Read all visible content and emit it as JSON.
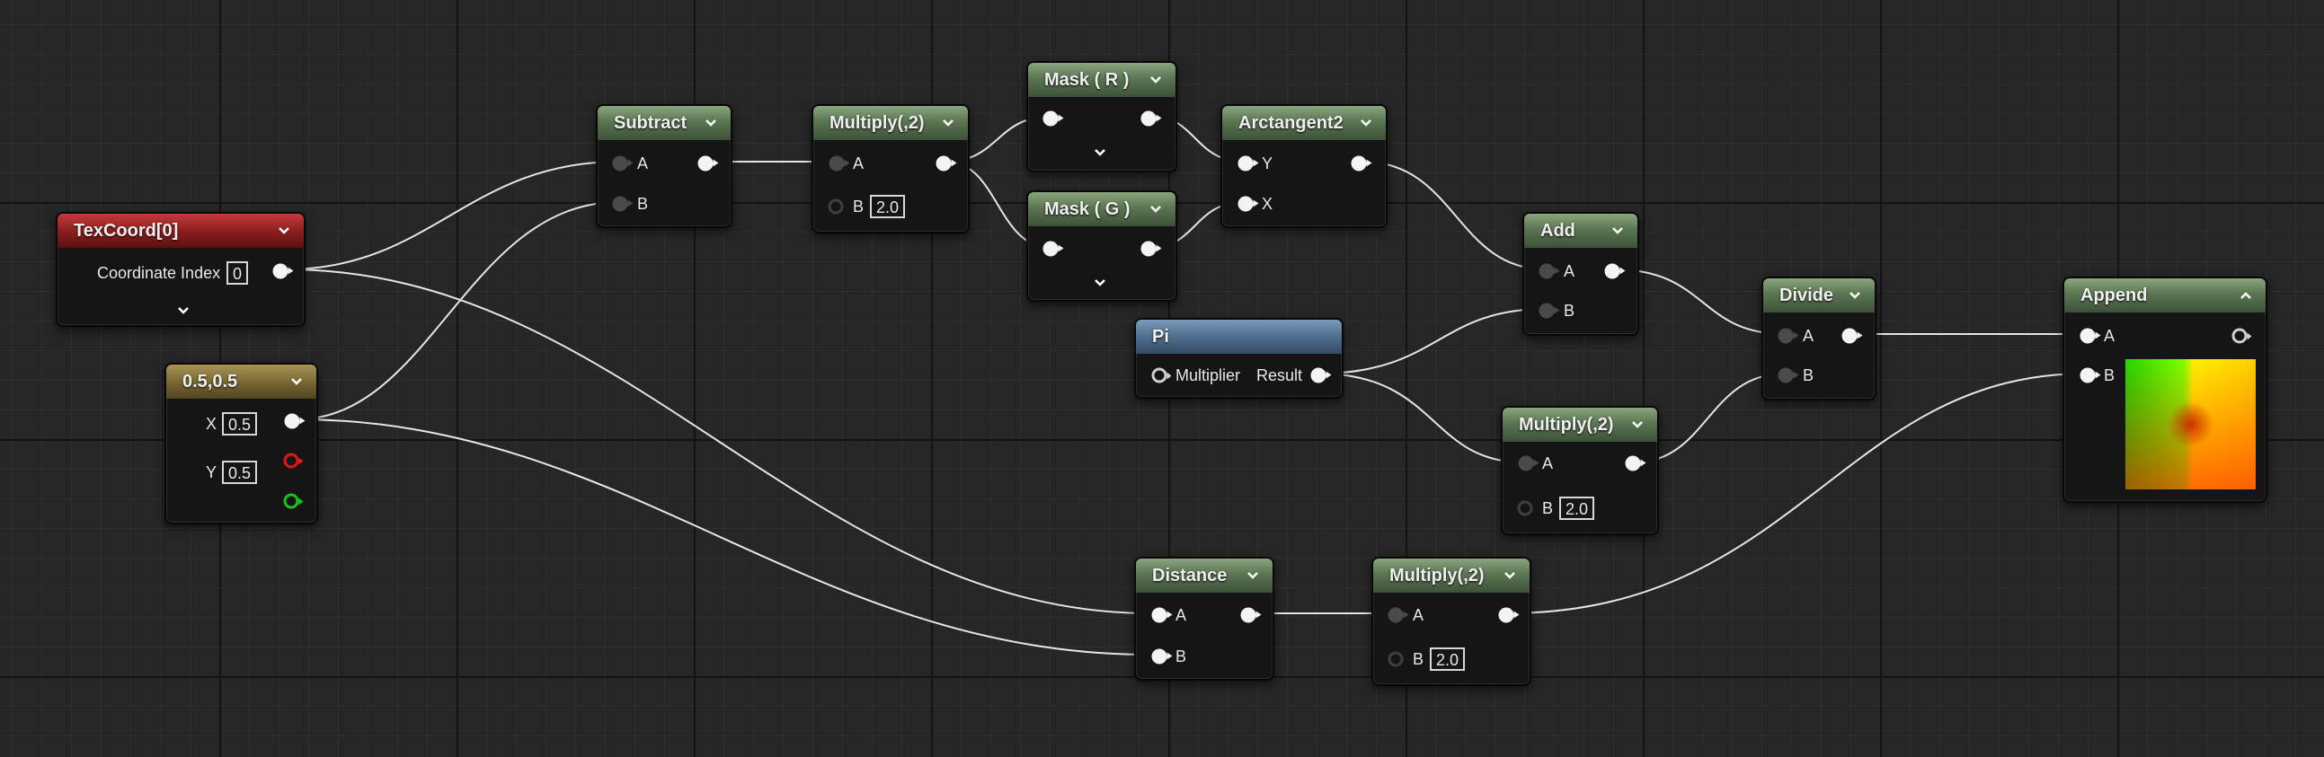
{
  "graph": {
    "texcoord": {
      "title": "TexCoord[0]",
      "coordinate_label": "Coordinate Index",
      "coordinate_value": "0"
    },
    "constant2": {
      "title": "0.5,0.5",
      "x_label": "X",
      "x_value": "0.5",
      "y_label": "Y",
      "y_value": "0.5"
    },
    "subtract": {
      "title": "Subtract",
      "a_label": "A",
      "b_label": "B"
    },
    "multiply1": {
      "title": "Multiply(,2)",
      "a_label": "A",
      "b_label": "B",
      "b_value": "2.0"
    },
    "mask_r": {
      "title": "Mask ( R )"
    },
    "mask_g": {
      "title": "Mask ( G )"
    },
    "arctangent2": {
      "title": "Arctangent2",
      "y_label": "Y",
      "x_label": "X"
    },
    "add": {
      "title": "Add",
      "a_label": "A",
      "b_label": "B"
    },
    "pi": {
      "title": "Pi",
      "multiplier_label": "Multiplier",
      "result_label": "Result"
    },
    "multiply2": {
      "title": "Multiply(,2)",
      "a_label": "A",
      "b_label": "B",
      "b_value": "2.0"
    },
    "divide": {
      "title": "Divide",
      "a_label": "A",
      "b_label": "B"
    },
    "append": {
      "title": "Append",
      "a_label": "A",
      "b_label": "B"
    },
    "distance": {
      "title": "Distance",
      "a_label": "A",
      "b_label": "B"
    },
    "multiply3": {
      "title": "Multiply(,2)",
      "a_label": "A",
      "b_label": "B",
      "b_value": "2.0"
    }
  },
  "colors": {
    "wire": "#e6e6e6",
    "header_green": "#5b7652",
    "header_red": "#8e1e1e",
    "header_gold": "#7a6934",
    "header_blue": "#4f6e8f",
    "pin_red": "#e01818",
    "pin_green": "#19c419"
  },
  "icons": {
    "collapse": "chevron-down-icon",
    "collapse_up": "chevron-up-icon",
    "expand": "chevron-down-icon"
  }
}
